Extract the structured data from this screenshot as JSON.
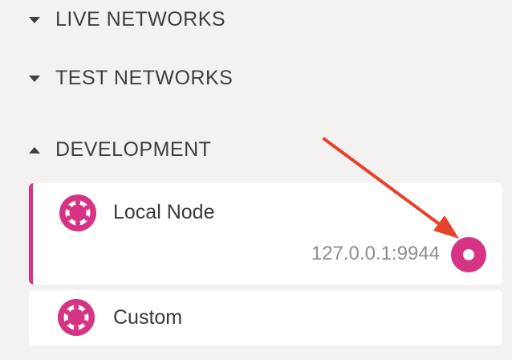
{
  "sections": {
    "live": {
      "label": "LIVE NETWORKS",
      "expanded": false
    },
    "test": {
      "label": "TEST NETWORKS",
      "expanded": false
    },
    "development": {
      "label": "DEVELOPMENT",
      "expanded": true
    }
  },
  "networks": [
    {
      "name": "Local Node",
      "endpoint": "127.0.0.1:9944",
      "selected": true,
      "icon": "polkadot-icon"
    },
    {
      "name": "Custom",
      "selected": false,
      "icon": "polkadot-icon"
    }
  ],
  "colors": {
    "accent": "#d63384",
    "background": "#f4f2f0",
    "card": "#ffffff",
    "annotation_arrow": "#e8412c"
  }
}
